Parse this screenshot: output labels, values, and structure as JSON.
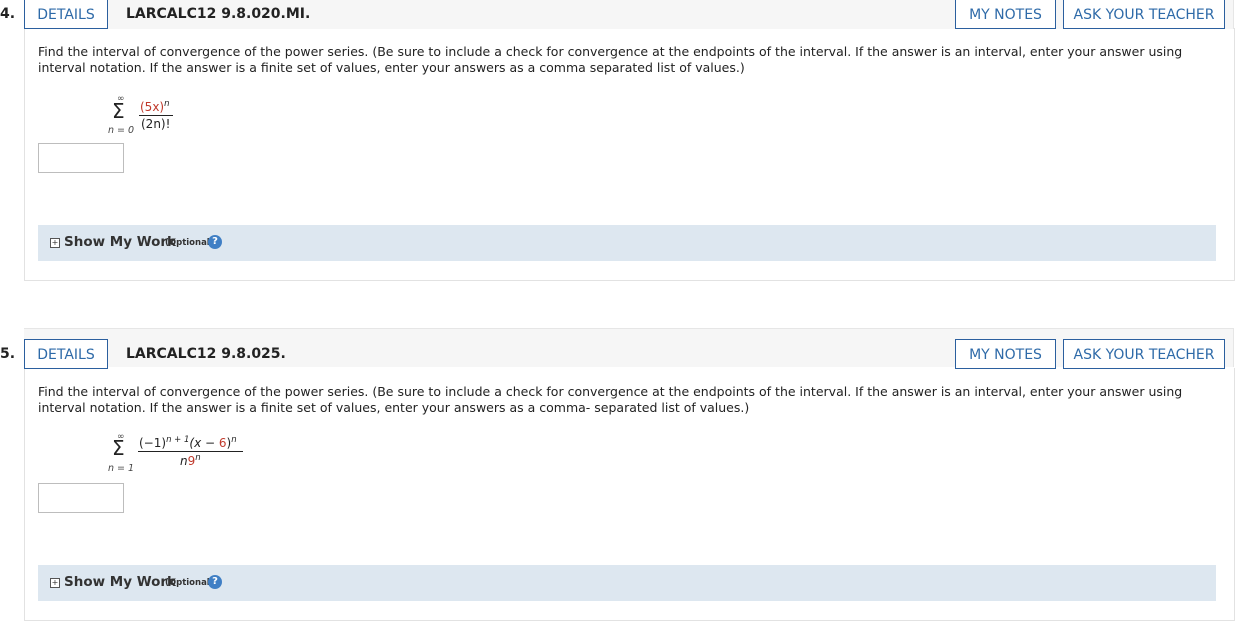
{
  "questions": [
    {
      "number": "4.",
      "details_label": "DETAILS",
      "code": "LARCALC12 9.8.020.MI.",
      "my_notes_label": "MY NOTES",
      "ask_teacher_label": "ASK YOUR TEACHER",
      "prompt": "Find the interval of convergence of the power series. (Be sure to include a check for convergence at the endpoints of the interval. If the answer is an interval, enter your answer using interval notation. If the answer is a finite set of values, enter your answers as a comma separated list of values.)",
      "series": {
        "upper": "∞",
        "lower": "n = 0",
        "numerator": "(5x)",
        "numerator_exp": "n",
        "denominator": "(2n)!"
      },
      "answer_value": "",
      "show_work_label": "Show My Work",
      "optional_label": "(Optional)",
      "help_glyph": "?"
    },
    {
      "number": "5.",
      "details_label": "DETAILS",
      "code": "LARCALC12 9.8.025.",
      "my_notes_label": "MY NOTES",
      "ask_teacher_label": "ASK YOUR TEACHER",
      "prompt": "Find the interval of convergence of the power series. (Be sure to include a check for convergence at the endpoints of the interval. If the answer is an interval, enter your answer using interval notation. If the answer is a finite set of values, enter your answers as a comma- separated list of values.)",
      "series": {
        "upper": "∞",
        "lower": "n = 1",
        "numerator_base": "(−1)",
        "numerator_base_exp": "n + 1",
        "numerator_paren": "(x − ",
        "numerator_const": "6",
        "numerator_close": ")",
        "numerator_exp": "n",
        "denominator_base": "n",
        "denominator_const": "9",
        "denominator_exp": "n"
      },
      "answer_value": "",
      "show_work_label": "Show My Work",
      "optional_label": "(Optional)",
      "help_glyph": "?"
    }
  ],
  "colors": {
    "accent": "#2e6aa8",
    "header_bg": "#f6f6f6",
    "work_bg": "#dde7f0",
    "highlight_red": "#c0392b"
  }
}
